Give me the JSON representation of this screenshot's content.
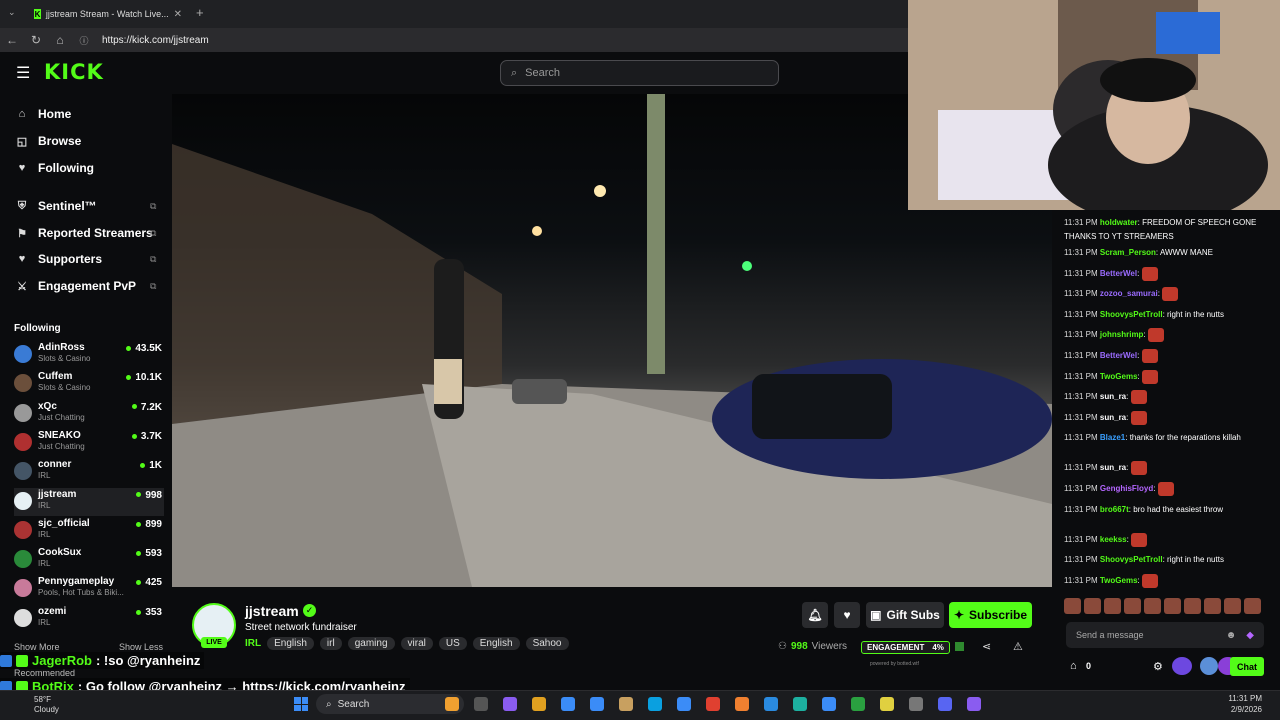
{
  "browser": {
    "tab_title": "jjstream Stream - Watch Live...",
    "url": "https://kick.com/jjstream"
  },
  "header": {
    "logo": "KICK",
    "search_placeholder": "Search"
  },
  "sidebar": {
    "nav": [
      {
        "label": "Home",
        "icon": "home-icon"
      },
      {
        "label": "Browse",
        "icon": "browse-icon"
      },
      {
        "label": "Following",
        "icon": "heart-icon"
      }
    ],
    "tools": [
      {
        "label": "Sentinel™",
        "icon": "shield-icon"
      },
      {
        "label": "Reported Streamers",
        "icon": "flag-icon"
      },
      {
        "label": "Supporters",
        "icon": "heart-icon"
      },
      {
        "label": "Engagement PvP",
        "icon": "swords-icon"
      }
    ],
    "following_heading": "Following",
    "channels": [
      {
        "name": "AdinRoss",
        "category": "Slots & Casino",
        "viewers": "43.5K",
        "color": "#3a7bd5"
      },
      {
        "name": "Cuffem",
        "category": "Slots & Casino",
        "viewers": "10.1K",
        "color": "#6b4f3b"
      },
      {
        "name": "xQc",
        "category": "Just Chatting",
        "viewers": "7.2K",
        "color": "#999999"
      },
      {
        "name": "SNEAKO",
        "category": "Just Chatting",
        "viewers": "3.7K",
        "color": "#b03030"
      },
      {
        "name": "conner",
        "category": "IRL",
        "viewers": "1K",
        "color": "#445566"
      },
      {
        "name": "jjstream",
        "category": "IRL",
        "viewers": "998",
        "color": "#e6f0f4"
      },
      {
        "name": "sjc_official",
        "category": "IRL",
        "viewers": "899",
        "color": "#a33"
      },
      {
        "name": "CookSux",
        "category": "IRL",
        "viewers": "593",
        "color": "#2a8a3a"
      },
      {
        "name": "Pennygameplay",
        "category": "Pools, Hot Tubs & Biki...",
        "viewers": "425",
        "color": "#c87a9a"
      },
      {
        "name": "ozemi",
        "category": "IRL",
        "viewers": "353",
        "color": "#dddddd"
      }
    ],
    "show_more": "Show More",
    "show_less": "Show Less",
    "recommended": "Recommended"
  },
  "chat": {
    "messages": [
      {
        "time": "11:31 PM",
        "user": "holdwater",
        "color": "#53fc18",
        "text": "FREEDOM OF SPEECH GONE THANKS TO YT STREAMERS"
      },
      {
        "time": "11:31 PM",
        "user": "Scram_Person",
        "color": "#53fc18",
        "text": "AWWW MANE"
      },
      {
        "time": "11:31 PM",
        "user": "BetterWel",
        "color": "#9b6cff",
        "text": ""
      },
      {
        "time": "11:31 PM",
        "user": "zozoo_samurai",
        "color": "#9b6cff",
        "text": ""
      },
      {
        "time": "11:31 PM",
        "user": "ShoovysPetTroll",
        "color": "#53fc18",
        "text": "right in the nutts"
      },
      {
        "time": "11:31 PM",
        "user": "johnshrimp",
        "color": "#53fc18",
        "text": ""
      },
      {
        "time": "11:31 PM",
        "user": "BetterWel",
        "color": "#9b6cff",
        "text": ""
      },
      {
        "time": "11:31 PM",
        "user": "TwoGems",
        "color": "#53fc18",
        "text": ""
      },
      {
        "time": "11:31 PM",
        "user": "sun_ra",
        "color": "#ffffff",
        "text": ""
      },
      {
        "time": "11:31 PM",
        "user": "sun_ra",
        "color": "#ffffff",
        "text": ""
      },
      {
        "time": "11:31 PM",
        "user": "Blaze1",
        "color": "#3aa0ff",
        "text": "thanks for the reparations killah"
      },
      {
        "time": "11:31 PM",
        "user": "sun_ra",
        "color": "#ffffff",
        "text": ""
      },
      {
        "time": "11:31 PM",
        "user": "GenghisFloyd",
        "color": "#b466ff",
        "text": ""
      },
      {
        "time": "11:31 PM",
        "user": "bro667t",
        "color": "#53fc18",
        "text": "bro had the easiest throw"
      },
      {
        "time": "11:31 PM",
        "user": "keekss",
        "color": "#53fc18",
        "text": ""
      },
      {
        "time": "11:31 PM",
        "user": "ShoovysPetTroll",
        "color": "#53fc18",
        "text": "right in the nutts"
      },
      {
        "time": "11:31 PM",
        "user": "TwoGems",
        "color": "#53fc18",
        "text": ""
      }
    ],
    "input_placeholder": "Send a message",
    "points": "0",
    "chat_button": "Chat"
  },
  "channel": {
    "name": "jjstream",
    "live_label": "LIVE",
    "title": "Street network fundraiser",
    "category": "IRL",
    "tags": [
      "English",
      "irl",
      "gaming",
      "viral",
      "US",
      "English",
      "Sahoo"
    ],
    "gift_subs": "Gift Subs",
    "subscribe": "Subscribe",
    "viewers_count": "998",
    "viewers_label": "Viewers",
    "engagement_label": "ENGAGEMENT",
    "engagement_value": "4%",
    "powered_by": "powered by botted.wtf"
  },
  "overlay": {
    "line1_user": "JagerRob",
    "line1_text": ": !so @ryanheinz",
    "line2_user": "BotRix",
    "line2_text": ": Go follow @ryanheinz → https://kick.com/ryanheinz"
  },
  "taskbar": {
    "weather_temp": "58°F",
    "weather_desc": "Cloudy",
    "search": "Search",
    "time": "11:31 PM",
    "date": "2/9/2026"
  },
  "colors": {
    "accent": "#53fc18",
    "background": "#0b0c0e"
  }
}
